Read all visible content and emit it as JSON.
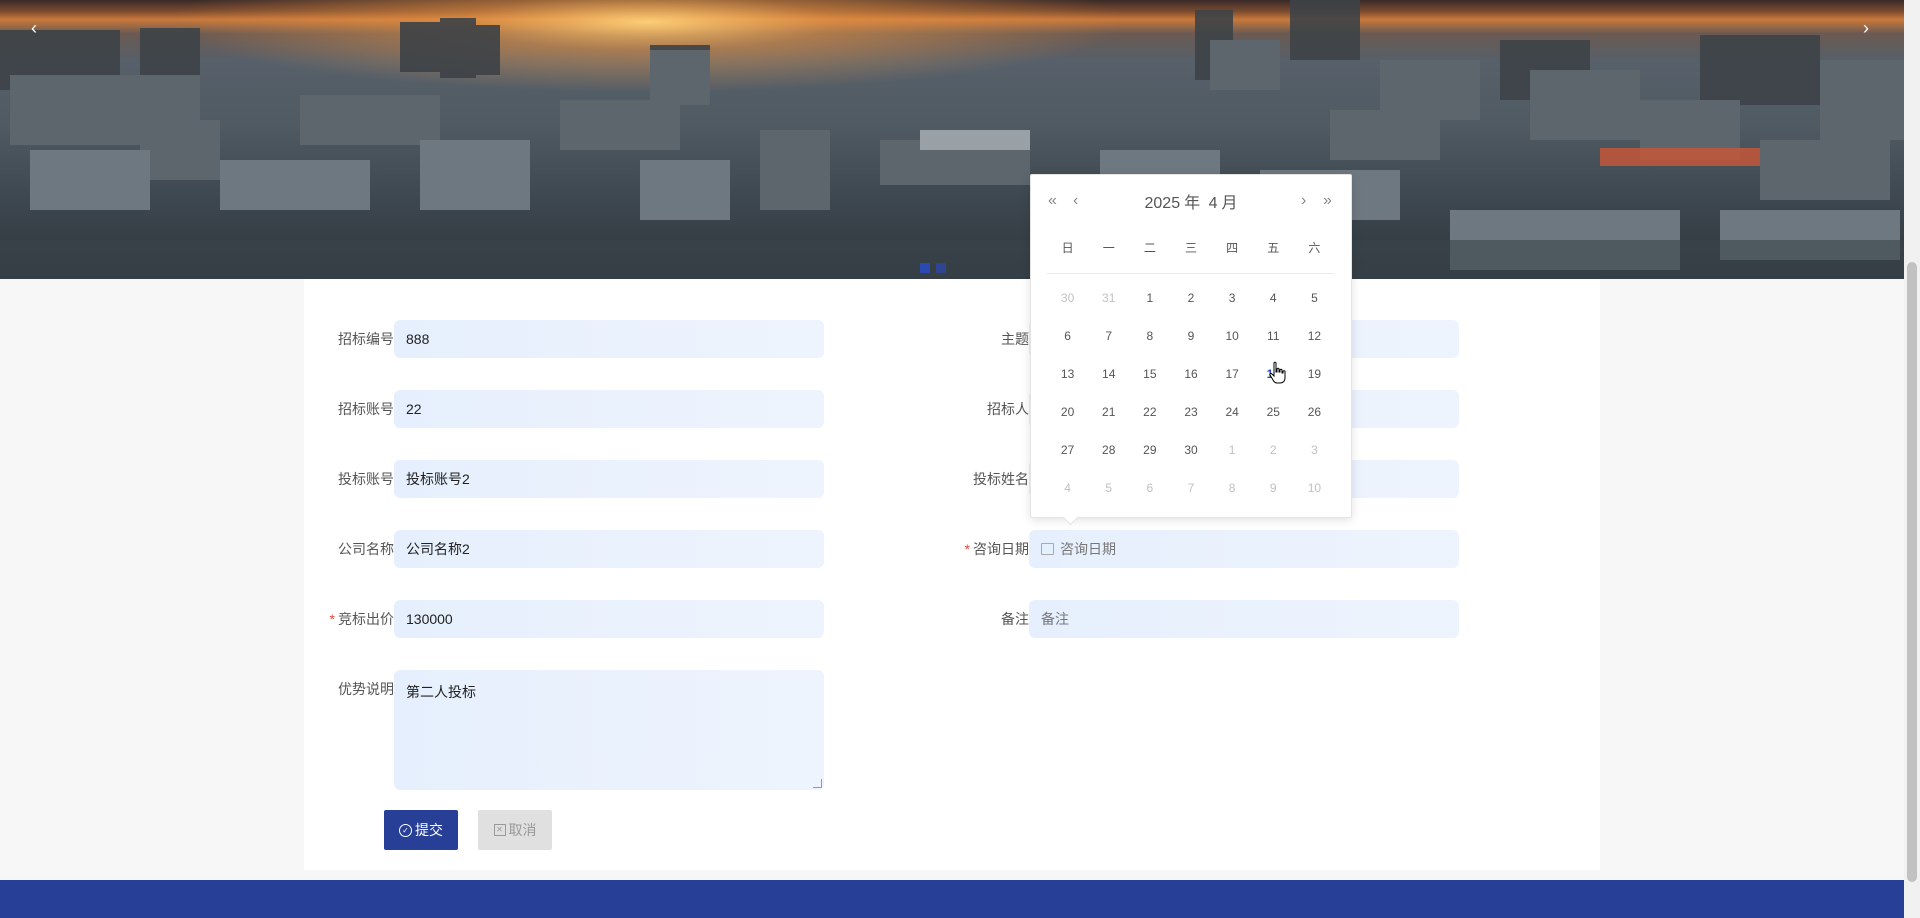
{
  "banner": {
    "prev": "‹",
    "next": "›"
  },
  "form": {
    "left": [
      {
        "label": "招标编号",
        "value": "888",
        "required": false
      },
      {
        "label": "招标账号",
        "value": "22",
        "required": false
      },
      {
        "label": "投标账号",
        "value": "投标账号2",
        "required": false
      },
      {
        "label": "公司名称",
        "value": "公司名称2",
        "required": false
      },
      {
        "label": "竞标出价",
        "value": "130000",
        "required": true
      },
      {
        "label": "优势说明",
        "value": "第二人投标",
        "required": false
      }
    ],
    "right": [
      {
        "label": "主题",
        "value": "",
        "required": false
      },
      {
        "label": "招标人",
        "value": "",
        "required": false
      },
      {
        "label": "投标姓名",
        "value": "",
        "required": false
      },
      {
        "label": "咨询日期",
        "value": "",
        "placeholder": "咨询日期",
        "required": true
      },
      {
        "label": "备注",
        "value": "",
        "placeholder": "备注",
        "required": false
      }
    ],
    "required_mark": "*",
    "submit_label": "提交",
    "cancel_label": "取消"
  },
  "datepicker": {
    "year": "2025",
    "year_suffix": "年",
    "month": "4",
    "month_suffix": "月",
    "nav": {
      "prev_year": "«",
      "prev_month": "‹",
      "next_month": "›",
      "next_year": "»"
    },
    "weekdays": [
      "日",
      "一",
      "二",
      "三",
      "四",
      "五",
      "六"
    ],
    "weeks": [
      [
        [
          "30",
          "other"
        ],
        [
          "31",
          "other"
        ],
        [
          "1",
          ""
        ],
        [
          "2",
          ""
        ],
        [
          "3",
          ""
        ],
        [
          "4",
          ""
        ],
        [
          "5",
          ""
        ]
      ],
      [
        [
          "6",
          ""
        ],
        [
          "7",
          ""
        ],
        [
          "8",
          ""
        ],
        [
          "9",
          ""
        ],
        [
          "10",
          ""
        ],
        [
          "11",
          ""
        ],
        [
          "12",
          ""
        ]
      ],
      [
        [
          "13",
          ""
        ],
        [
          "14",
          ""
        ],
        [
          "15",
          ""
        ],
        [
          "16",
          ""
        ],
        [
          "17",
          ""
        ],
        [
          "18",
          "today"
        ],
        [
          "19",
          ""
        ]
      ],
      [
        [
          "20",
          ""
        ],
        [
          "21",
          ""
        ],
        [
          "22",
          ""
        ],
        [
          "23",
          ""
        ],
        [
          "24",
          ""
        ],
        [
          "25",
          ""
        ],
        [
          "26",
          ""
        ]
      ],
      [
        [
          "27",
          ""
        ],
        [
          "28",
          ""
        ],
        [
          "29",
          ""
        ],
        [
          "30",
          ""
        ],
        [
          "1",
          "other"
        ],
        [
          "2",
          "other"
        ],
        [
          "3",
          "other"
        ]
      ],
      [
        [
          "4",
          "other"
        ],
        [
          "5",
          "other"
        ],
        [
          "6",
          "other"
        ],
        [
          "7",
          "other"
        ],
        [
          "8",
          "other"
        ],
        [
          "9",
          "other"
        ],
        [
          "10",
          "other"
        ]
      ]
    ]
  },
  "colors": {
    "primary": "#273f97",
    "required": "#e04a3a",
    "input_bg": "#e6effd"
  }
}
